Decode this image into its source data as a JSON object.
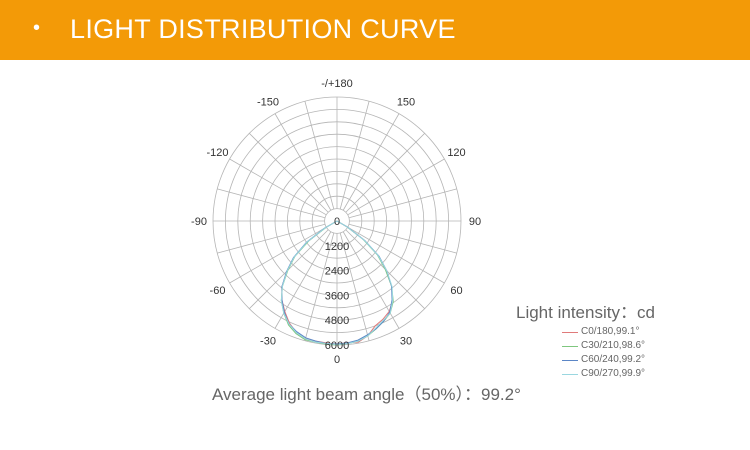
{
  "header": {
    "bullet": "•",
    "title": "LIGHT DISTRIBUTION CURVE",
    "bg_color": "#f39a07"
  },
  "chart_data": {
    "type": "polar-line",
    "angular_labels": [
      {
        "angle": 0,
        "text": "0"
      },
      {
        "angle": 30,
        "text": "30"
      },
      {
        "angle": 60,
        "text": "60"
      },
      {
        "angle": 90,
        "text": "90"
      },
      {
        "angle": 120,
        "text": "120"
      },
      {
        "angle": 150,
        "text": "150"
      },
      {
        "angle": 180,
        "text": "-/+180"
      },
      {
        "angle": -150,
        "text": "-150"
      },
      {
        "angle": -120,
        "text": "-120"
      },
      {
        "angle": -90,
        "text": "-90"
      },
      {
        "angle": -60,
        "text": "-60"
      },
      {
        "angle": -30,
        "text": "-30"
      }
    ],
    "radial_labels": [
      "0",
      "1200",
      "2400",
      "3600",
      "4800",
      "6000"
    ],
    "radial_max": 6000,
    "radial_ticks": [
      0,
      1200,
      2400,
      3600,
      4800,
      6000
    ],
    "angular_step_deg": 15,
    "series": [
      {
        "name": "C0/180,99.1°",
        "color": "#e07a7a",
        "points": [
          [
            -90,
            0
          ],
          [
            -75,
            0
          ],
          [
            -65,
            0
          ],
          [
            -60,
            650
          ],
          [
            -55,
            1700
          ],
          [
            -50,
            2700
          ],
          [
            -45,
            3400
          ],
          [
            -40,
            4150
          ],
          [
            -35,
            4650
          ],
          [
            -30,
            5050
          ],
          [
            -25,
            5450
          ],
          [
            -20,
            5750
          ],
          [
            -15,
            5900
          ],
          [
            -10,
            5900
          ],
          [
            -5,
            5920
          ],
          [
            0,
            5960
          ],
          [
            5,
            5900
          ],
          [
            10,
            5950
          ],
          [
            15,
            5750
          ],
          [
            20,
            5400
          ],
          [
            25,
            5250
          ],
          [
            30,
            5050
          ],
          [
            35,
            4700
          ],
          [
            40,
            4100
          ],
          [
            45,
            3400
          ],
          [
            50,
            2600
          ],
          [
            55,
            1600
          ],
          [
            60,
            600
          ],
          [
            65,
            0
          ],
          [
            90,
            0
          ]
        ]
      },
      {
        "name": "C30/210,98.6°",
        "color": "#7fc77f",
        "points": [
          [
            -90,
            0
          ],
          [
            -75,
            0
          ],
          [
            -65,
            0
          ],
          [
            -60,
            600
          ],
          [
            -55,
            1650
          ],
          [
            -50,
            2650
          ],
          [
            -45,
            3350
          ],
          [
            -40,
            4100
          ],
          [
            -35,
            4700
          ],
          [
            -30,
            5150
          ],
          [
            -25,
            5550
          ],
          [
            -20,
            5800
          ],
          [
            -15,
            5950
          ],
          [
            -10,
            5950
          ],
          [
            -5,
            5980
          ],
          [
            0,
            6000
          ],
          [
            5,
            5950
          ],
          [
            10,
            5900
          ],
          [
            15,
            5750
          ],
          [
            20,
            5550
          ],
          [
            25,
            5350
          ],
          [
            30,
            5150
          ],
          [
            35,
            4750
          ],
          [
            40,
            4100
          ],
          [
            45,
            3300
          ],
          [
            50,
            2550
          ],
          [
            55,
            1550
          ],
          [
            60,
            550
          ],
          [
            65,
            0
          ],
          [
            90,
            0
          ]
        ]
      },
      {
        "name": "C60/240,99.2°",
        "color": "#5b86c6",
        "points": [
          [
            -90,
            0
          ],
          [
            -75,
            0
          ],
          [
            -65,
            0
          ],
          [
            -60,
            700
          ],
          [
            -55,
            1800
          ],
          [
            -50,
            2750
          ],
          [
            -45,
            3450
          ],
          [
            -40,
            4150
          ],
          [
            -35,
            4650
          ],
          [
            -30,
            5100
          ],
          [
            -25,
            5500
          ],
          [
            -20,
            5700
          ],
          [
            -15,
            5850
          ],
          [
            -10,
            5900
          ],
          [
            -5,
            5950
          ],
          [
            0,
            5950
          ],
          [
            5,
            5920
          ],
          [
            10,
            5850
          ],
          [
            15,
            5700
          ],
          [
            20,
            5550
          ],
          [
            25,
            5350
          ],
          [
            30,
            5100
          ],
          [
            35,
            4650
          ],
          [
            40,
            4100
          ],
          [
            45,
            3400
          ],
          [
            50,
            2650
          ],
          [
            55,
            1650
          ],
          [
            60,
            600
          ],
          [
            65,
            0
          ],
          [
            90,
            0
          ]
        ]
      },
      {
        "name": "C90/270,99.9°",
        "color": "#9ad7e0",
        "points": [
          [
            -90,
            0
          ],
          [
            -75,
            0
          ],
          [
            -65,
            0
          ],
          [
            -60,
            650
          ],
          [
            -55,
            1750
          ],
          [
            -50,
            2700
          ],
          [
            -45,
            3400
          ],
          [
            -40,
            4100
          ],
          [
            -35,
            4700
          ],
          [
            -30,
            5150
          ],
          [
            -25,
            5500
          ],
          [
            -20,
            5750
          ],
          [
            -15,
            5900
          ],
          [
            -10,
            5950
          ],
          [
            -5,
            5950
          ],
          [
            0,
            5980
          ],
          [
            5,
            5950
          ],
          [
            10,
            5900
          ],
          [
            15,
            5750
          ],
          [
            20,
            5500
          ],
          [
            25,
            5300
          ],
          [
            30,
            5150
          ],
          [
            35,
            4700
          ],
          [
            40,
            4150
          ],
          [
            45,
            3400
          ],
          [
            50,
            2600
          ],
          [
            55,
            1600
          ],
          [
            60,
            580
          ],
          [
            65,
            0
          ],
          [
            90,
            0
          ]
        ]
      }
    ]
  },
  "intensity_label": {
    "text": "Light intensity：cd"
  },
  "beam_angle": {
    "text": "Average light beam angle（50%）：99.2°"
  }
}
